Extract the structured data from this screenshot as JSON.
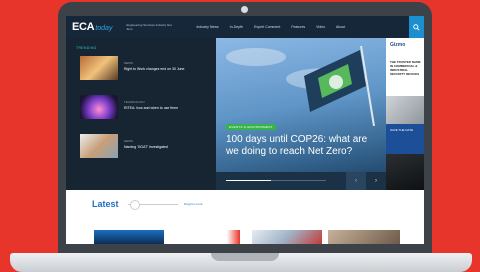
{
  "header": {
    "logo_main": "ECA",
    "logo_sub": "today",
    "tagline": "Engineering Services Industry Net Zero",
    "nav": [
      "Industry News",
      "In-Depth",
      "Expert Comment",
      "Features",
      "Video",
      "About"
    ],
    "search_icon": "search-icon"
  },
  "trending": {
    "title": "TRENDING",
    "items": [
      {
        "category": "NEWS",
        "headline": "Right to Work changes end on 30 June"
      },
      {
        "category": "TECHNOLOGY",
        "headline": "RITEA: how and when to use them"
      },
      {
        "category": "NEWS",
        "headline": "Naming 'GOAT' Investigated"
      }
    ]
  },
  "hero": {
    "tag": "EVENTS & ENVIRONMENT",
    "title": "100 days until COP26: what are we doing to reach Net Zero?",
    "progress": 0.45,
    "prev_icon": "chevron-left-icon",
    "next_icon": "chevron-right-icon"
  },
  "ad": {
    "logo": "Gizmo",
    "text": "THE TRUSTED NAME IN COMMERCIAL & INDUSTRIAL SECURITY DEVICES",
    "blue_text": "SAVE THE DATE"
  },
  "latest": {
    "title": "Latest",
    "drag_hint": "Drag for more"
  },
  "colors": {
    "background": "#e8352b",
    "header": "#17273a",
    "accent": "#1e6fc1",
    "trending": "#2ec3d0",
    "tag": "#35b44a"
  }
}
